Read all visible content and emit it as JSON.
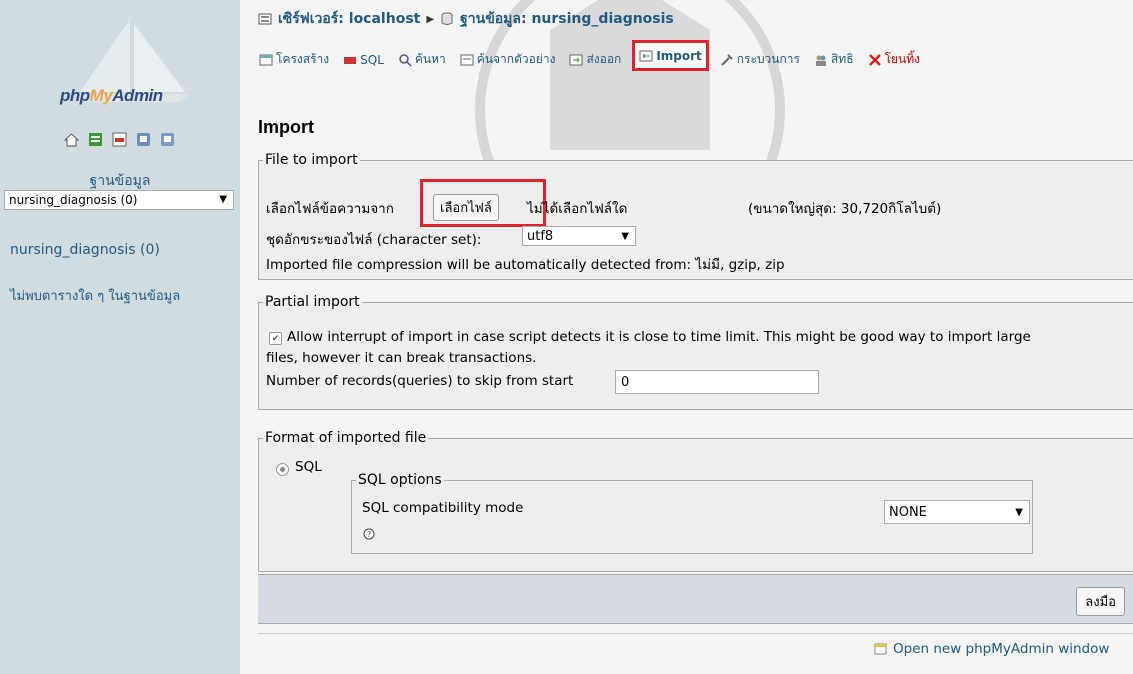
{
  "logo": {
    "prefix": "php",
    "my": "My",
    "suffix": "Admin"
  },
  "left": {
    "db_label": "ฐานข้อมูล",
    "db_select_value": "nursing_diagnosis (0)",
    "db_link": "nursing_diagnosis (0)",
    "no_tables": "ไม่พบตารางใด ๆ ในฐานข้อมูล"
  },
  "breadcrumb": {
    "server": "เซิร์ฟเวอร์: localhost",
    "database": "ฐานข้อมูล: nursing_diagnosis"
  },
  "tabs": [
    {
      "label": "โครงสร้าง"
    },
    {
      "label": "SQL"
    },
    {
      "label": "ค้นหา"
    },
    {
      "label": "ค้นจากตัวอย่าง"
    },
    {
      "label": "ส่งออก"
    },
    {
      "label": "Import"
    },
    {
      "label": "กระบวนการ"
    },
    {
      "label": "สิทธิ"
    },
    {
      "label": "โยนทิ้ง"
    }
  ],
  "page_title": "Import",
  "file_to_import": {
    "legend": "File to import",
    "browse_label": "เลือกไฟล์ข้อความจาก",
    "browse_button": "เลือกไฟล์",
    "no_file": "ไม่ได้เลือกไฟล์ใด",
    "max_size": "(ขนาดใหญ่สุด: 30,720กิโลไบต์)",
    "charset_label": "ชุดอักขระของไฟล์ (character set):",
    "charset_value": "utf8",
    "compression_note": "Imported file compression will be automatically detected from: ไม่มี, gzip, zip"
  },
  "partial_import": {
    "legend": "Partial import",
    "allow_interrupt_line1": "Allow interrupt of import in case script detects it is close to time limit. This might be good way to import large",
    "allow_interrupt_line2": "files, however it can break transactions.",
    "skip_label": "Number of records(queries) to skip from start",
    "skip_value": "0"
  },
  "format": {
    "legend": "Format of imported file",
    "sql_option": "SQL",
    "sql_options_legend": "SQL options",
    "compat_label": "SQL compatibility mode",
    "compat_value": "NONE"
  },
  "submit_label": "ลงมือ",
  "footer_link": "Open new phpMyAdmin window",
  "colors": {
    "link": "#235a81",
    "highlight": "#e0242d",
    "sidebar": "#d0dce0"
  }
}
